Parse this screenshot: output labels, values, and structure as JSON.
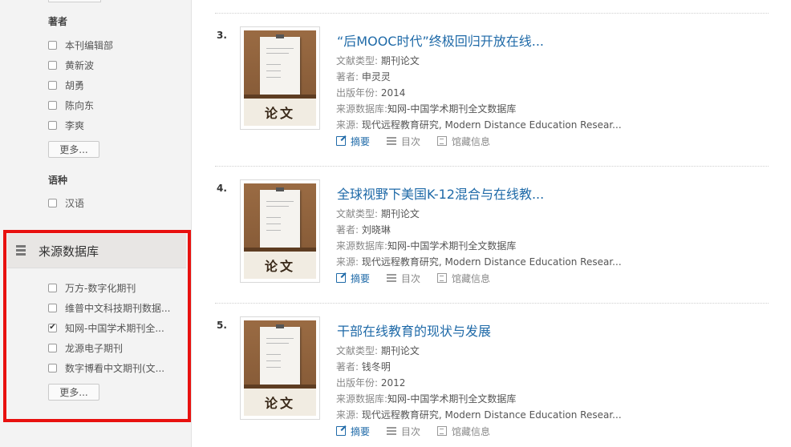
{
  "sidebar": {
    "author_title": "著者",
    "authors": [
      {
        "label": "本刊编辑部",
        "checked": false
      },
      {
        "label": "黄新波",
        "checked": false
      },
      {
        "label": "胡勇",
        "checked": false
      },
      {
        "label": "陈向东",
        "checked": false
      },
      {
        "label": "李爽",
        "checked": false
      }
    ],
    "more_label": "更多...",
    "language_title": "语种",
    "languages": [
      {
        "label": "汉语",
        "checked": false
      }
    ],
    "database_title": "来源数据库",
    "databases": [
      {
        "label": "万方-数字化期刊",
        "checked": false
      },
      {
        "label": "维普中文科技期刊数据...",
        "checked": false
      },
      {
        "label": "知网-中国学术期刊全...",
        "checked": true
      },
      {
        "label": "龙源电子期刊",
        "checked": false
      },
      {
        "label": "数字博看中文期刊(文...",
        "checked": false
      }
    ],
    "highlight_color": "#e8110f"
  },
  "results": [
    {
      "number": "3.",
      "title": "“后MOOC时代”终极回归开放在线...",
      "thumb_label": "论文",
      "meta": [
        {
          "label": "文献类型:",
          "value": "期刊论文"
        },
        {
          "label": "著者:",
          "value": "申灵灵"
        },
        {
          "label": "出版年份:",
          "value": "2014"
        },
        {
          "label": "来源数据库:",
          "value": "知网-中国学术期刊全文数据库"
        },
        {
          "label": "来源:",
          "value": "现代远程教育研究, Modern Distance Education Resear..."
        }
      ]
    },
    {
      "number": "4.",
      "title": "全球视野下美国K-12混合与在线教...",
      "thumb_label": "论文",
      "meta": [
        {
          "label": "文献类型:",
          "value": "期刊论文"
        },
        {
          "label": "著者:",
          "value": "刘晓琳"
        },
        {
          "label": "来源数据库:",
          "value": "知网-中国学术期刊全文数据库"
        },
        {
          "label": "来源:",
          "value": "现代远程教育研究, Modern Distance Education Resear..."
        }
      ]
    },
    {
      "number": "5.",
      "title": "干部在线教育的现状与发展",
      "thumb_label": "论文",
      "meta": [
        {
          "label": "文献类型:",
          "value": "期刊论文"
        },
        {
          "label": "著者:",
          "value": "钱冬明"
        },
        {
          "label": "出版年份:",
          "value": "2012"
        },
        {
          "label": "来源数据库:",
          "value": "知网-中国学术期刊全文数据库"
        },
        {
          "label": "来源:",
          "value": "现代远程教育研究, Modern Distance Education Resear..."
        }
      ]
    }
  ],
  "actions": {
    "summary": "摘要",
    "toc": "目次",
    "holdings": "馆藏信息"
  },
  "colors": {
    "link": "#1f6aa8",
    "sidebar_bg": "#f3f3f3"
  }
}
